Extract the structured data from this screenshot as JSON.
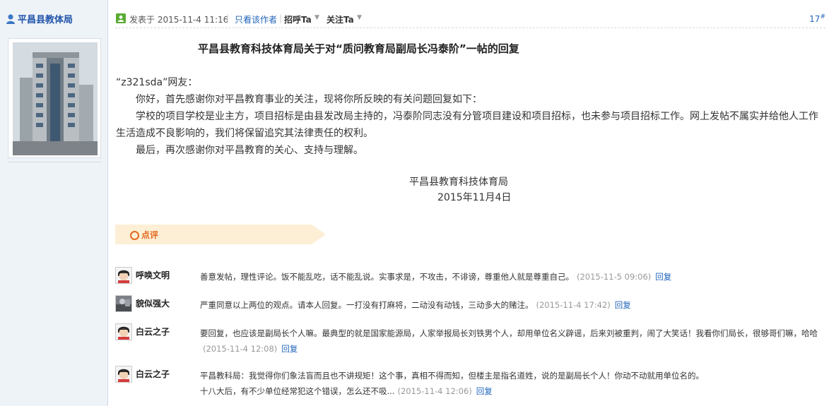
{
  "sidebar": {
    "author_name": "平昌县教体局"
  },
  "meta": {
    "post_time": "发表于 2015-11-4 11:16",
    "separator": "|",
    "only_author": "只看该作者",
    "greet": "招呼Ta",
    "follow": "关注Ta",
    "floor_number": "17",
    "floor_mark": "#"
  },
  "post": {
    "title": "平昌县教育科技体育局关于对“质问教育局副局长冯泰阶”一帖的回复",
    "salutation": "“z321sda”网友：",
    "paragraphs": [
      "你好，首先感谢你对平昌教育事业的关注，现将你所反映的有关问题回复如下：",
      "学校的项目学校是业主方，项目招标是由县发改局主持的，冯泰阶同志没有分管项目建设和项目招标，也未参与项目招标工作。网上发帖不属实并给他人工作生活造成不良影响的，我们将保留追究其法律责任的权利。",
      "最后，再次感谢你对平昌教育的关心、支持与理解。"
    ],
    "signature_org": "平昌县教育科技体育局",
    "signature_date": "2015年11月4日"
  },
  "comments_tab": {
    "label": "点评"
  },
  "comments": [
    {
      "name": "呼唤文明",
      "text": "善意发帖，理性评论。饭不能乱吃，话不能乱说。实事求是，不攻击，不诽谤，尊重他人就是尊重自己。",
      "time": "(2015-11-5 09:06)",
      "reply": "回复"
    },
    {
      "name": "貌似强大",
      "text": "严重同意以上两位的观点。请本人回复。一打没有打麻将，二动没有动钱，三动多大的赌注。",
      "time": "(2015-11-4 17:42)",
      "reply": "回复"
    },
    {
      "name": "白云之子",
      "text": "要回复，也应该是副局长个人嘛。最典型的就是国家能源局，人家举报局长刘铁男个人，却用单位名义辟谣，后来刘被重判，闹了大笑话！我看你们局长，很够哥们嘛，哈哈",
      "time": "(2015-11-4 12:08)",
      "reply": "回复"
    },
    {
      "name": "白云之子",
      "text": "平昌教科局：我觉得你们象法盲而且也不讲规矩！这个事，真相不得而知，但楼主是指名道姓，说的是副局长个人！你动不动就用单位名的。十八大后，有不少单位经常犯这个错误，怎么还不吸...",
      "time": "(2015-11-4 12:06)",
      "reply": "回复"
    }
  ]
}
